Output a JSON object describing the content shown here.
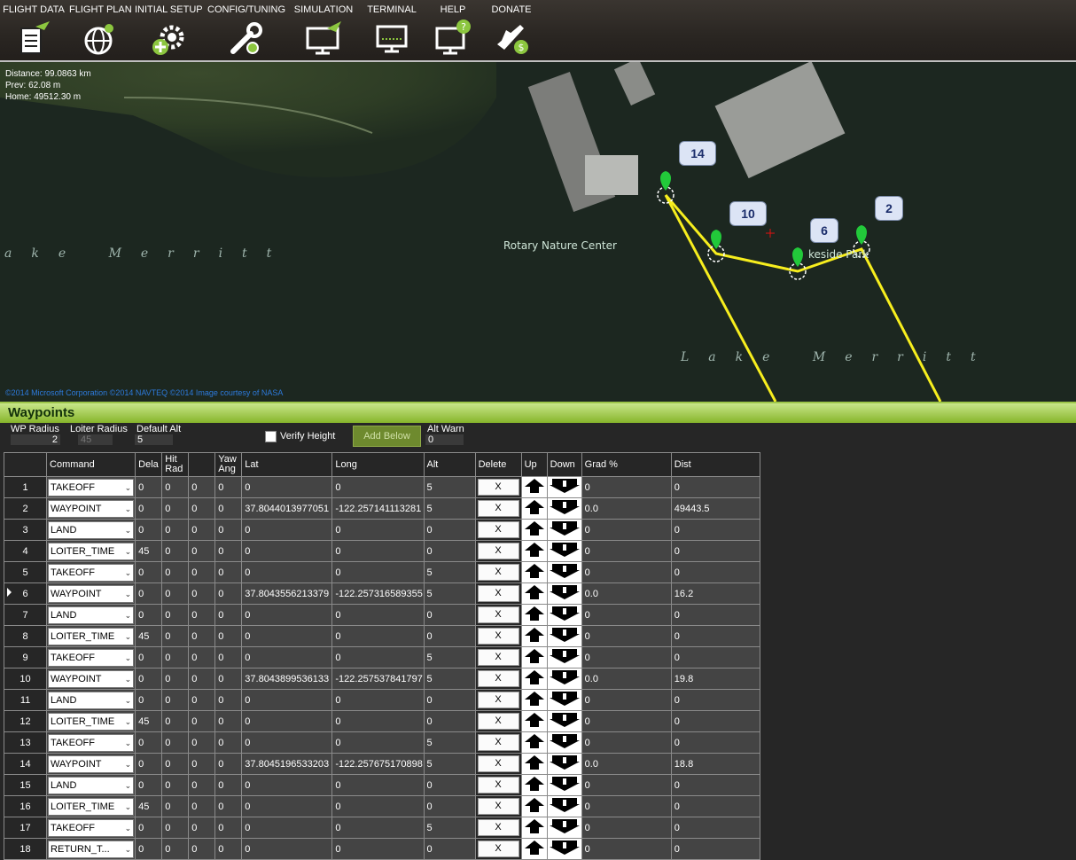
{
  "topmenu": [
    {
      "label": "FLIGHT DATA",
      "icon": "flight-data-icon"
    },
    {
      "label": "FLIGHT PLAN",
      "icon": "flight-plan-icon"
    },
    {
      "label": "INITIAL SETUP",
      "icon": "initial-setup-icon"
    },
    {
      "label": "CONFIG/TUNING",
      "icon": "config-tuning-icon"
    },
    {
      "label": "SIMULATION",
      "icon": "simulation-icon"
    },
    {
      "label": "TERMINAL",
      "icon": "terminal-icon"
    },
    {
      "label": "HELP",
      "icon": "help-icon"
    },
    {
      "label": "DONATE",
      "icon": "donate-icon"
    }
  ],
  "map": {
    "distance": "Distance: 99.0863 km",
    "prev": "Prev: 62.08 m",
    "home": "Home: 49512.30 m",
    "labels": {
      "nature_center": "Rotary Nature Center",
      "lake1": "ake Merritt",
      "lake2": "Lake Merritt",
      "park": "keside Park"
    },
    "badges": [
      "14",
      "10",
      "6",
      "2"
    ],
    "copyright": "©2014 Microsoft Corporation ©2014 NAVTEQ ©2014 Image courtesy of NASA",
    "route_color": "#f7ee1e",
    "marker_color": "#22c93a"
  },
  "waypoints": {
    "title": "Waypoints",
    "wp_radius_label": "WP Radius",
    "wp_radius": "2",
    "loiter_radius_label": "Loiter Radius",
    "loiter_radius": "45",
    "default_alt_label": "Default Alt",
    "default_alt": "5",
    "verify_height_label": "Verify Height",
    "add_below_label": "Add Below",
    "alt_warn_label": "Alt Warn",
    "alt_warn": "0",
    "columns": [
      "Command",
      "Dela",
      "Hit Rad",
      "",
      "Yaw Ang",
      "Lat",
      "Long",
      "Alt",
      "Delete",
      "Up",
      "Down",
      "Grad %",
      "Dist"
    ],
    "rows": [
      {
        "n": "1",
        "cmd": "TAKEOFF",
        "dela": "0",
        "hit": "0",
        "p3": "0",
        "yaw": "0",
        "lat": "0",
        "long": "0",
        "alt": "5",
        "grad": "0",
        "dist": "0"
      },
      {
        "n": "2",
        "cmd": "WAYPOINT",
        "dela": "0",
        "hit": "0",
        "p3": "0",
        "yaw": "0",
        "lat": "37.8044013977051",
        "long": "-122.257141113281",
        "alt": "5",
        "grad": "0.0",
        "dist": "49443.5"
      },
      {
        "n": "3",
        "cmd": "LAND",
        "dela": "0",
        "hit": "0",
        "p3": "0",
        "yaw": "0",
        "lat": "0",
        "long": "0",
        "alt": "0",
        "grad": "0",
        "dist": "0"
      },
      {
        "n": "4",
        "cmd": "LOITER_TIME",
        "dela": "45",
        "hit": "0",
        "p3": "0",
        "yaw": "0",
        "lat": "0",
        "long": "0",
        "alt": "0",
        "grad": "0",
        "dist": "0"
      },
      {
        "n": "5",
        "cmd": "TAKEOFF",
        "dela": "0",
        "hit": "0",
        "p3": "0",
        "yaw": "0",
        "lat": "0",
        "long": "0",
        "alt": "5",
        "grad": "0",
        "dist": "0"
      },
      {
        "n": "6",
        "cmd": "WAYPOINT",
        "dela": "0",
        "hit": "0",
        "p3": "0",
        "yaw": "0",
        "lat": "37.8043556213379",
        "long": "-122.257316589355",
        "alt": "5",
        "grad": "0.0",
        "dist": "16.2"
      },
      {
        "n": "7",
        "cmd": "LAND",
        "dela": "0",
        "hit": "0",
        "p3": "0",
        "yaw": "0",
        "lat": "0",
        "long": "0",
        "alt": "0",
        "grad": "0",
        "dist": "0"
      },
      {
        "n": "8",
        "cmd": "LOITER_TIME",
        "dela": "45",
        "hit": "0",
        "p3": "0",
        "yaw": "0",
        "lat": "0",
        "long": "0",
        "alt": "0",
        "grad": "0",
        "dist": "0"
      },
      {
        "n": "9",
        "cmd": "TAKEOFF",
        "dela": "0",
        "hit": "0",
        "p3": "0",
        "yaw": "0",
        "lat": "0",
        "long": "0",
        "alt": "5",
        "grad": "0",
        "dist": "0"
      },
      {
        "n": "10",
        "cmd": "WAYPOINT",
        "dela": "0",
        "hit": "0",
        "p3": "0",
        "yaw": "0",
        "lat": "37.8043899536133",
        "long": "-122.257537841797",
        "alt": "5",
        "grad": "0.0",
        "dist": "19.8"
      },
      {
        "n": "11",
        "cmd": "LAND",
        "dela": "0",
        "hit": "0",
        "p3": "0",
        "yaw": "0",
        "lat": "0",
        "long": "0",
        "alt": "0",
        "grad": "0",
        "dist": "0"
      },
      {
        "n": "12",
        "cmd": "LOITER_TIME",
        "dela": "45",
        "hit": "0",
        "p3": "0",
        "yaw": "0",
        "lat": "0",
        "long": "0",
        "alt": "0",
        "grad": "0",
        "dist": "0"
      },
      {
        "n": "13",
        "cmd": "TAKEOFF",
        "dela": "0",
        "hit": "0",
        "p3": "0",
        "yaw": "0",
        "lat": "0",
        "long": "0",
        "alt": "5",
        "grad": "0",
        "dist": "0"
      },
      {
        "n": "14",
        "cmd": "WAYPOINT",
        "dela": "0",
        "hit": "0",
        "p3": "0",
        "yaw": "0",
        "lat": "37.8045196533203",
        "long": "-122.257675170898",
        "alt": "5",
        "grad": "0.0",
        "dist": "18.8"
      },
      {
        "n": "15",
        "cmd": "LAND",
        "dela": "0",
        "hit": "0",
        "p3": "0",
        "yaw": "0",
        "lat": "0",
        "long": "0",
        "alt": "0",
        "grad": "0",
        "dist": "0"
      },
      {
        "n": "16",
        "cmd": "LOITER_TIME",
        "dela": "45",
        "hit": "0",
        "p3": "0",
        "yaw": "0",
        "lat": "0",
        "long": "0",
        "alt": "0",
        "grad": "0",
        "dist": "0"
      },
      {
        "n": "17",
        "cmd": "TAKEOFF",
        "dela": "0",
        "hit": "0",
        "p3": "0",
        "yaw": "0",
        "lat": "0",
        "long": "0",
        "alt": "5",
        "grad": "0",
        "dist": "0"
      },
      {
        "n": "18",
        "cmd": "RETURN_T...",
        "dela": "0",
        "hit": "0",
        "p3": "0",
        "yaw": "0",
        "lat": "0",
        "long": "0",
        "alt": "0",
        "grad": "0",
        "dist": "0"
      }
    ],
    "current_row": "6",
    "delete_label": "X"
  }
}
